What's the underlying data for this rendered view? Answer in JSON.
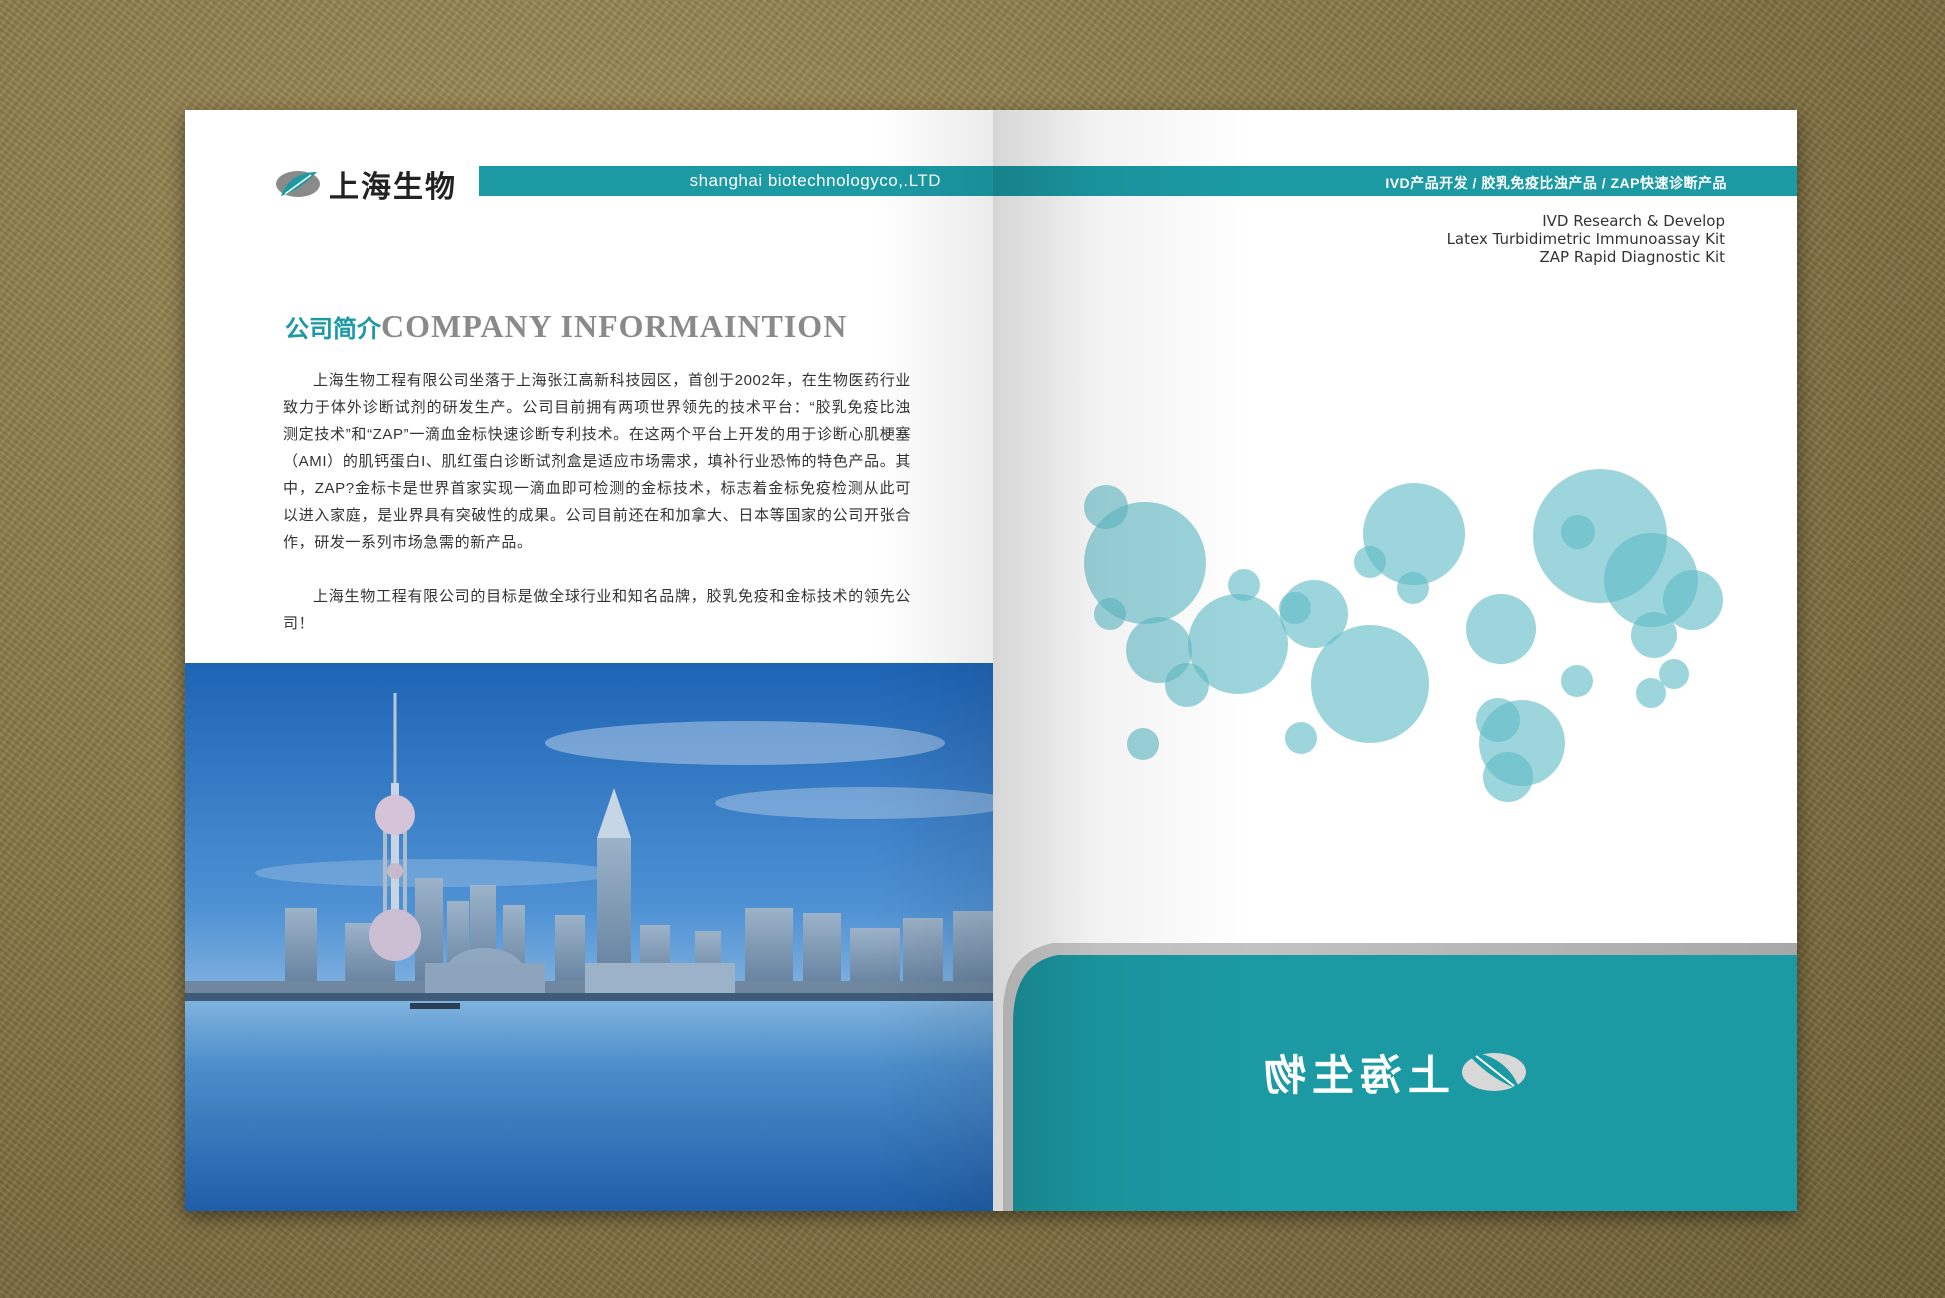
{
  "brand": {
    "name_cn": "上海生物",
    "name_en": "shanghai biotechnologyco,.LTD",
    "color_primary": "#1b9aa4",
    "color_bubble": "#5fbcc6"
  },
  "header_right": {
    "product_line": "IVD产品开发 / 胶乳免疫比浊产品 / ZAP快速诊断产品",
    "tagline": [
      "IVD Research & Develop",
      "Latex Turbidimetric Immunoassay Kit",
      "ZAP Rapid Diagnostic Kit"
    ]
  },
  "intro": {
    "title_cn": "公司简介",
    "title_en": "COMPANY INFORMAINTION",
    "paragraphs": [
      "上海生物工程有限公司坐落于上海张江高新科技园区，首创于2002年，在生物医药行业致力于体外诊断试剂的研发生产。公司目前拥有两项世界领先的技术平台：“胶乳免疫比浊测定技术”和“ZAP”一滴血金标快速诊断专利技术。在这两个平台上开发的用于诊断心肌梗塞（AMI）的肌钙蛋白I、肌红蛋白诊断试剂盒是适应市场需求，填补行业恐怖的特色产品。其中，ZAP?金标卡是世界首家实现一滴血即可检测的金标技术，标志着金标免疫检测从此可以进入家庭，是业界具有突破性的成果。公司目前还在和加拿大、日本等国家的公司开张合作，研发一系列市场急需的新产品。",
      "上海生物工程有限公司的目标是做全球行业和知名品牌，胶乳免疫和金标技术的领先公司！"
    ]
  },
  "right_page": {
    "bottom_logo_text": "上海生物",
    "bottom_logo_mirrored": true
  },
  "icons": {
    "logo": "leaf-logo-icon"
  }
}
